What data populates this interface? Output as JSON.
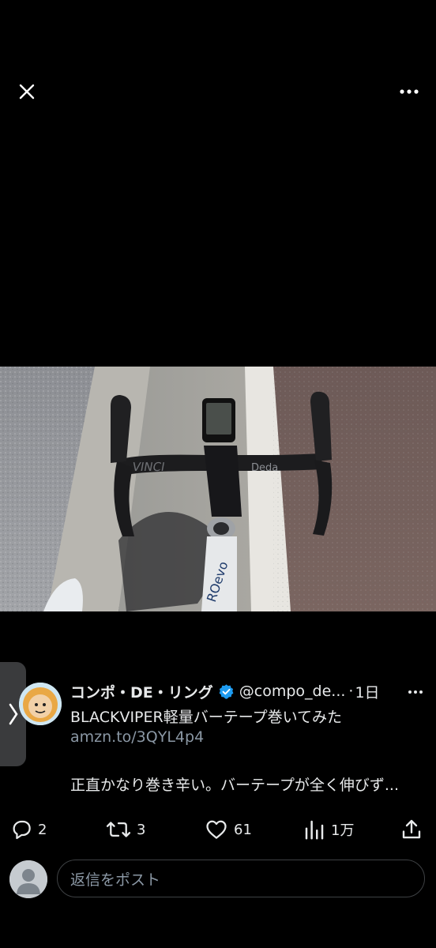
{
  "topbar": {
    "close_icon": "close-icon",
    "more_icon": "more-horizontal-icon"
  },
  "media": {
    "icon": "photo-handlebar-with-gps-computer",
    "brand_marks": [
      "VINCI",
      "Deda",
      "ROevo"
    ]
  },
  "side_handle": {
    "icon": "chevron-right-icon"
  },
  "tweet": {
    "author_name": "コンポ・DE・リング",
    "verified_icon": "verified-badge-icon",
    "handle": "@compo_de...",
    "separator": "·",
    "time": "1日",
    "text_line1": "BLACKVIPER軽量バーテープ巻いてみた",
    "link": "amzn.to/3QYL4p4",
    "text_line3": "正直かなり巻き辛い。バーテープが全く伸びず...",
    "more_icon": "more-horizontal-icon"
  },
  "actions": {
    "reply_count": "2",
    "retweet_count": "3",
    "like_count": "61",
    "views_count": "1万"
  },
  "reply_box": {
    "placeholder": "返信をポスト"
  },
  "colors": {
    "background": "#000000",
    "text": "#e7e9ea",
    "secondary": "#8b98a5",
    "verified": "#1d9bf0",
    "handle_bg": "#3a3b3d"
  }
}
